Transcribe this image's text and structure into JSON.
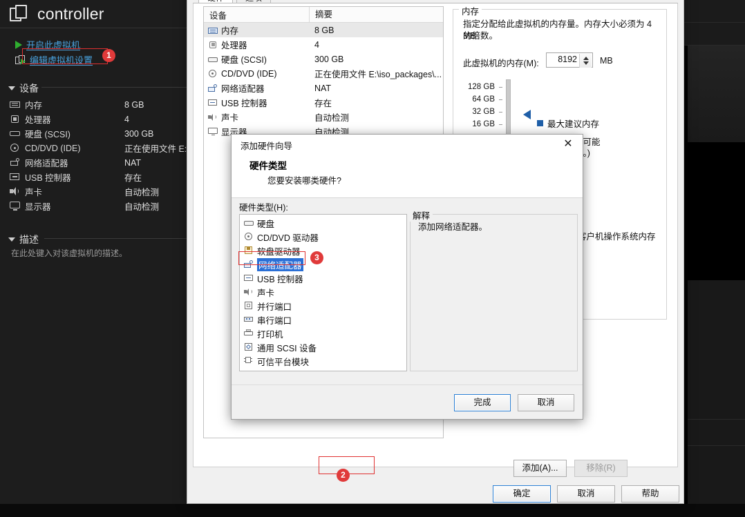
{
  "sidebar": {
    "vm_name": "controller",
    "actions": [
      {
        "label": "开启此虚拟机",
        "icon": "play-icon"
      },
      {
        "label": "编辑虚拟机设置",
        "icon": "edit-settings-icon"
      }
    ],
    "devices_section": "设备",
    "devices": [
      {
        "name": "内存",
        "value": "8 GB",
        "icon": "memory-icon"
      },
      {
        "name": "处理器",
        "value": "4",
        "icon": "cpu-icon"
      },
      {
        "name": "硬盘 (SCSI)",
        "value": "300 GB",
        "icon": "harddisk-icon"
      },
      {
        "name": "CD/DVD (IDE)",
        "value": "正在使用文件 E:\\",
        "icon": "cddvd-icon"
      },
      {
        "name": "网络适配器",
        "value": "NAT",
        "icon": "network-icon"
      },
      {
        "name": "USB 控制器",
        "value": "存在",
        "icon": "usb-icon"
      },
      {
        "name": "声卡",
        "value": "自动检测",
        "icon": "sound-icon"
      },
      {
        "name": "显示器",
        "value": "自动检测",
        "icon": "display-icon"
      }
    ],
    "description_section": "描述",
    "description_placeholder": "在此处键入对该虚拟机的描述。"
  },
  "settings_dialog": {
    "tabs": [
      {
        "label": "硬件",
        "selected": true
      },
      {
        "label": "选项",
        "selected": false
      }
    ],
    "table": {
      "headers": [
        "设备",
        "摘要"
      ],
      "rows": [
        {
          "device": "内存",
          "summary": "8 GB",
          "icon": "memory-icon",
          "selected": true
        },
        {
          "device": "处理器",
          "summary": "4",
          "icon": "cpu-icon",
          "selected": false
        },
        {
          "device": "硬盘 (SCSI)",
          "summary": "300 GB",
          "icon": "harddisk-icon",
          "selected": false
        },
        {
          "device": "CD/DVD (IDE)",
          "summary": "正在使用文件 E:\\iso_packages\\...",
          "icon": "cddvd-icon",
          "selected": false
        },
        {
          "device": "网络适配器",
          "summary": "NAT",
          "icon": "network-icon",
          "selected": false
        },
        {
          "device": "USB 控制器",
          "summary": "存在",
          "icon": "usb-icon",
          "selected": false
        },
        {
          "device": "声卡",
          "summary": "自动检测",
          "icon": "sound-icon",
          "selected": false
        },
        {
          "device": "显示器",
          "summary": "自动检测",
          "icon": "display-icon",
          "selected": false
        }
      ]
    },
    "add_button": "添加(A)...",
    "remove_button": "移除(R)",
    "memory_panel": {
      "group_title": "内存",
      "description_line1": "指定分配给此虚拟机的内存量。内存大小必须为 4 MB",
      "description_line2": "的倍数。",
      "field_label": "此虚拟机的内存(M):",
      "field_value": "8192",
      "unit": "MB",
      "scale_labels": [
        "128 GB",
        "64 GB",
        "32 GB",
        "16 GB"
      ],
      "legend": [
        {
          "text": "最大建议内存",
          "color": "#1f5fa8"
        },
        {
          "text": "小可能",
          "color": "#1f5fa8"
        },
        {
          "text": "换。)",
          "color": "#1f5fa8"
        },
        {
          "text": "客户机操作系统内存",
          "color": "#1f5fa8"
        }
      ]
    },
    "footer_buttons": [
      {
        "label": "确定",
        "default": true
      },
      {
        "label": "取消",
        "default": false
      },
      {
        "label": "帮助",
        "default": false
      }
    ]
  },
  "wizard": {
    "caption": "添加硬件向导",
    "close_icon": "✕",
    "heading": "硬件类型",
    "subheading": "您要安装哪类硬件?",
    "list_label": "硬件类型(H):",
    "hardware_types": [
      {
        "label": "硬盘",
        "icon": "harddisk-icon",
        "selected": false
      },
      {
        "label": "CD/DVD 驱动器",
        "icon": "cddvd-icon",
        "selected": false
      },
      {
        "label": "软盘驱动器",
        "icon": "floppy-icon",
        "selected": false
      },
      {
        "label": "网络适配器",
        "icon": "network-icon",
        "selected": true
      },
      {
        "label": "USB 控制器",
        "icon": "usb-icon",
        "selected": false
      },
      {
        "label": "声卡",
        "icon": "sound-icon",
        "selected": false
      },
      {
        "label": "并行端口",
        "icon": "parallel-icon",
        "selected": false
      },
      {
        "label": "串行端口",
        "icon": "serial-icon",
        "selected": false
      },
      {
        "label": "打印机",
        "icon": "printer-icon",
        "selected": false
      },
      {
        "label": "通用 SCSI 设备",
        "icon": "scsi-icon",
        "selected": false
      },
      {
        "label": "可信平台模块",
        "icon": "tpm-icon",
        "selected": false
      }
    ],
    "explanation_title": "解释",
    "explanation_text": "添加网络适配器。",
    "finish_button": "完成",
    "cancel_button": "取消"
  },
  "annotations": [
    {
      "badge": "1",
      "target": "edit-vm-settings-link"
    },
    {
      "badge": "2",
      "target": "add-hardware-button"
    },
    {
      "badge": "3",
      "target": "network-adapter-list-item"
    }
  ],
  "colors": {
    "accent_blue": "#2a6fd6",
    "annotation_red": "#e03a3a",
    "link_blue": "#4aa3df",
    "legend_blue": "#1f5fa8"
  }
}
